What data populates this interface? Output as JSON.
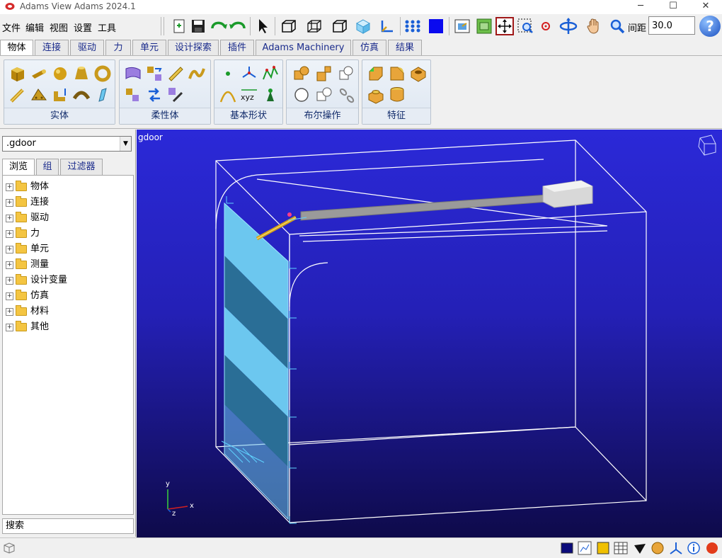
{
  "window": {
    "title": "Adams View Adams 2024.1",
    "minimize": "─",
    "maximize": "☐",
    "close": "✕"
  },
  "menu": {
    "file": "文件",
    "edit": "编辑",
    "view": "视图",
    "settings": "设置",
    "tools": "工具"
  },
  "toolbar": {
    "grid_label": "间距",
    "grid_value": "30.0",
    "help": "?"
  },
  "ribbon_tabs": [
    "物体",
    "连接",
    "驱动",
    "力",
    "单元",
    "设计探索",
    "插件",
    "Adams Machinery",
    "仿真",
    "结果"
  ],
  "ribbon_groups": {
    "solid": "实体",
    "flexible": "柔性体",
    "basic_shapes": "基本形状",
    "boolean": "布尔操作",
    "features": "特征"
  },
  "left_panel": {
    "model": ".gdoor",
    "tabs": [
      "浏览",
      "组",
      "过滤器"
    ],
    "tree": [
      "物体",
      "连接",
      "驱动",
      "力",
      "单元",
      "测量",
      "设计变量",
      "仿真",
      "材料",
      "其他"
    ],
    "search_label": "搜索",
    "expander": "+"
  },
  "viewport": {
    "model_name": "gdoor",
    "axis_x": "x",
    "axis_y": "y",
    "axis_z": "z",
    "xyz_label": "xyz"
  },
  "colors": {
    "viewport_top": "#2b29d8",
    "viewport_bottom": "#0e0a4a",
    "door_panel": "#6cc7ef",
    "door_panel_dark": "#2a6e96",
    "tab_text": "#1a2b8c"
  }
}
